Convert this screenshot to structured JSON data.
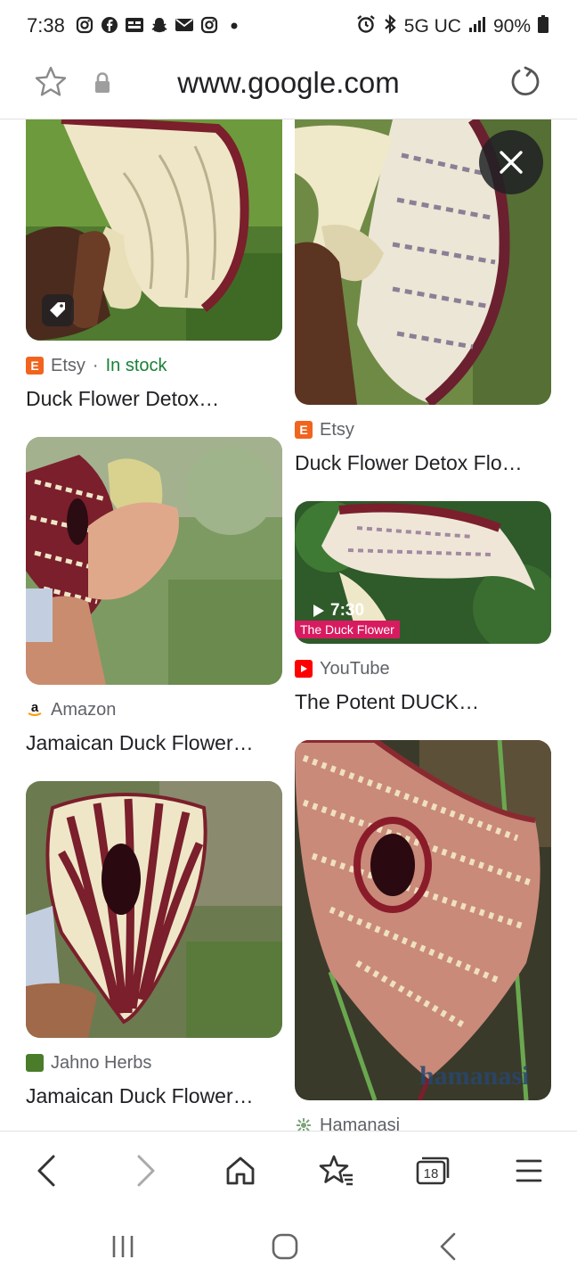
{
  "status_bar": {
    "time": "7:38",
    "network": "5G UC",
    "battery": "90%",
    "left_icons": [
      "instagram-icon",
      "facebook-icon",
      "chat-icon",
      "snapchat-icon",
      "mail-icon",
      "instagram-icon",
      "dot-icon"
    ],
    "right_icons": [
      "alarm-icon",
      "bluetooth-icon",
      "signal-icon",
      "battery-icon"
    ]
  },
  "url_bar": {
    "url": "www.google.com",
    "icons": [
      "star-icon",
      "lock-icon",
      "reload-icon"
    ]
  },
  "results": [
    {
      "source": "Etsy",
      "stock": "In stock",
      "title": "Duck Flower Detox…",
      "source_icon": "etsy-icon",
      "badge_icon": "tag-icon"
    },
    {
      "source": "Etsy",
      "title": "Duck Flower Detox Flo…",
      "source_icon": "etsy-icon"
    },
    {
      "source": "Amazon",
      "title": "Jamaican Duck Flower…",
      "source_icon": "amazon-icon"
    },
    {
      "source": "YouTube",
      "title": "The Potent DUCK…",
      "source_icon": "youtube-icon",
      "duration": "7:30",
      "video_label": "The Duck Flower"
    },
    {
      "source": "Jahno Herbs",
      "title": "Jamaican Duck Flower…",
      "source_icon": "jahno-herbs-icon"
    },
    {
      "source": "Hamanasi",
      "source_icon": "hamanasi-icon",
      "watermark": "hamanasi"
    }
  ],
  "close_icon": "close-icon",
  "bottom_nav": {
    "tab_count": "18",
    "icons": [
      "back-icon",
      "forward-icon",
      "home-icon",
      "bookmarks-icon",
      "tabs-icon",
      "menu-icon"
    ]
  },
  "system_nav": {
    "icons": [
      "recents-icon",
      "home-circle-icon",
      "system-back-icon"
    ]
  },
  "colors": {
    "stock_green": "#188038",
    "etsy_orange": "#f1641e",
    "youtube_red": "#ff0000",
    "flower_maroon": "#7a1f2b",
    "flower_cream": "#efe6c8"
  }
}
